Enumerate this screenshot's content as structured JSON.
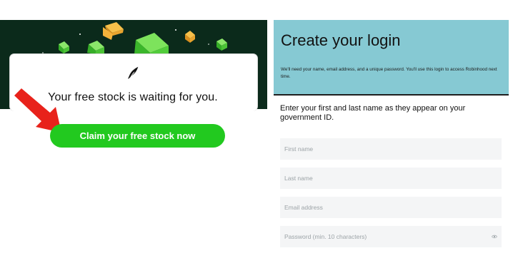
{
  "promo": {
    "headline": "Your free stock is waiting for you.",
    "cta_label": "Claim your free stock now",
    "colors": {
      "hero_bg": "#0b2a1b",
      "cta": "#22c91f",
      "arrow": "#e8221b"
    },
    "icons": [
      "feather-logo-icon",
      "red-arrow-icon",
      "cube-icon"
    ]
  },
  "signup": {
    "title": "Create your login",
    "description": "We'll need your name, email address, and a unique password. You'll use this login to access Robinhood next time.",
    "instruction": "Enter your first and last name as they appear on your government ID.",
    "fields": {
      "first_name_placeholder": "First name",
      "last_name_placeholder": "Last name",
      "email_placeholder": "Email address",
      "password_placeholder": "Password (min. 10 characters)"
    },
    "banner_color": "#86c9d3"
  }
}
